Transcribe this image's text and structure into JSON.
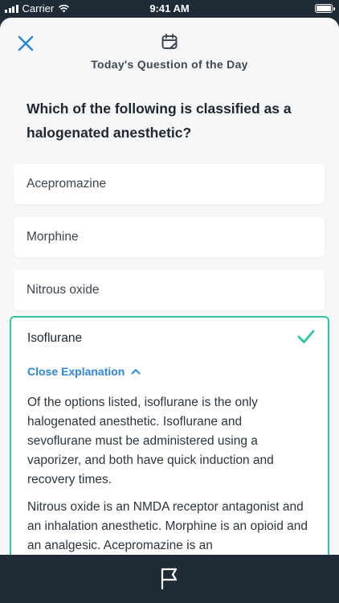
{
  "status_bar": {
    "carrier": "Carrier",
    "time": "9:41 AM",
    "battery_level": 1.0
  },
  "header": {
    "subtitle": "Today's Question of the Day",
    "close_icon": "close-icon",
    "calendar_icon": "calendar-icon"
  },
  "question": "Which of the following is classified as a halogenated anesthetic?",
  "options": [
    {
      "label": "Acepromazine"
    },
    {
      "label": "Morphine"
    },
    {
      "label": "Nitrous oxide"
    }
  ],
  "selected_option": {
    "label": "Isoflurane",
    "correct": true,
    "toggle_label": "Close Explanation",
    "explanation": [
      "Of the options listed, isoflurane is the only halogenated anesthetic. Isoflurane and sevoflurane must be administered using a vaporizer, and both have quick induction and recovery times.",
      "Nitrous oxide is an NMDA receptor antagonist and an inhalation anesthetic. Morphine is an opioid and an analgesic. Acepromazine is an"
    ]
  },
  "colors": {
    "accent": "#2e86d8",
    "correct": "#2fc4a0",
    "background": "#1f2b36"
  },
  "bottom_bar": {
    "flag_icon": "flag-icon"
  }
}
